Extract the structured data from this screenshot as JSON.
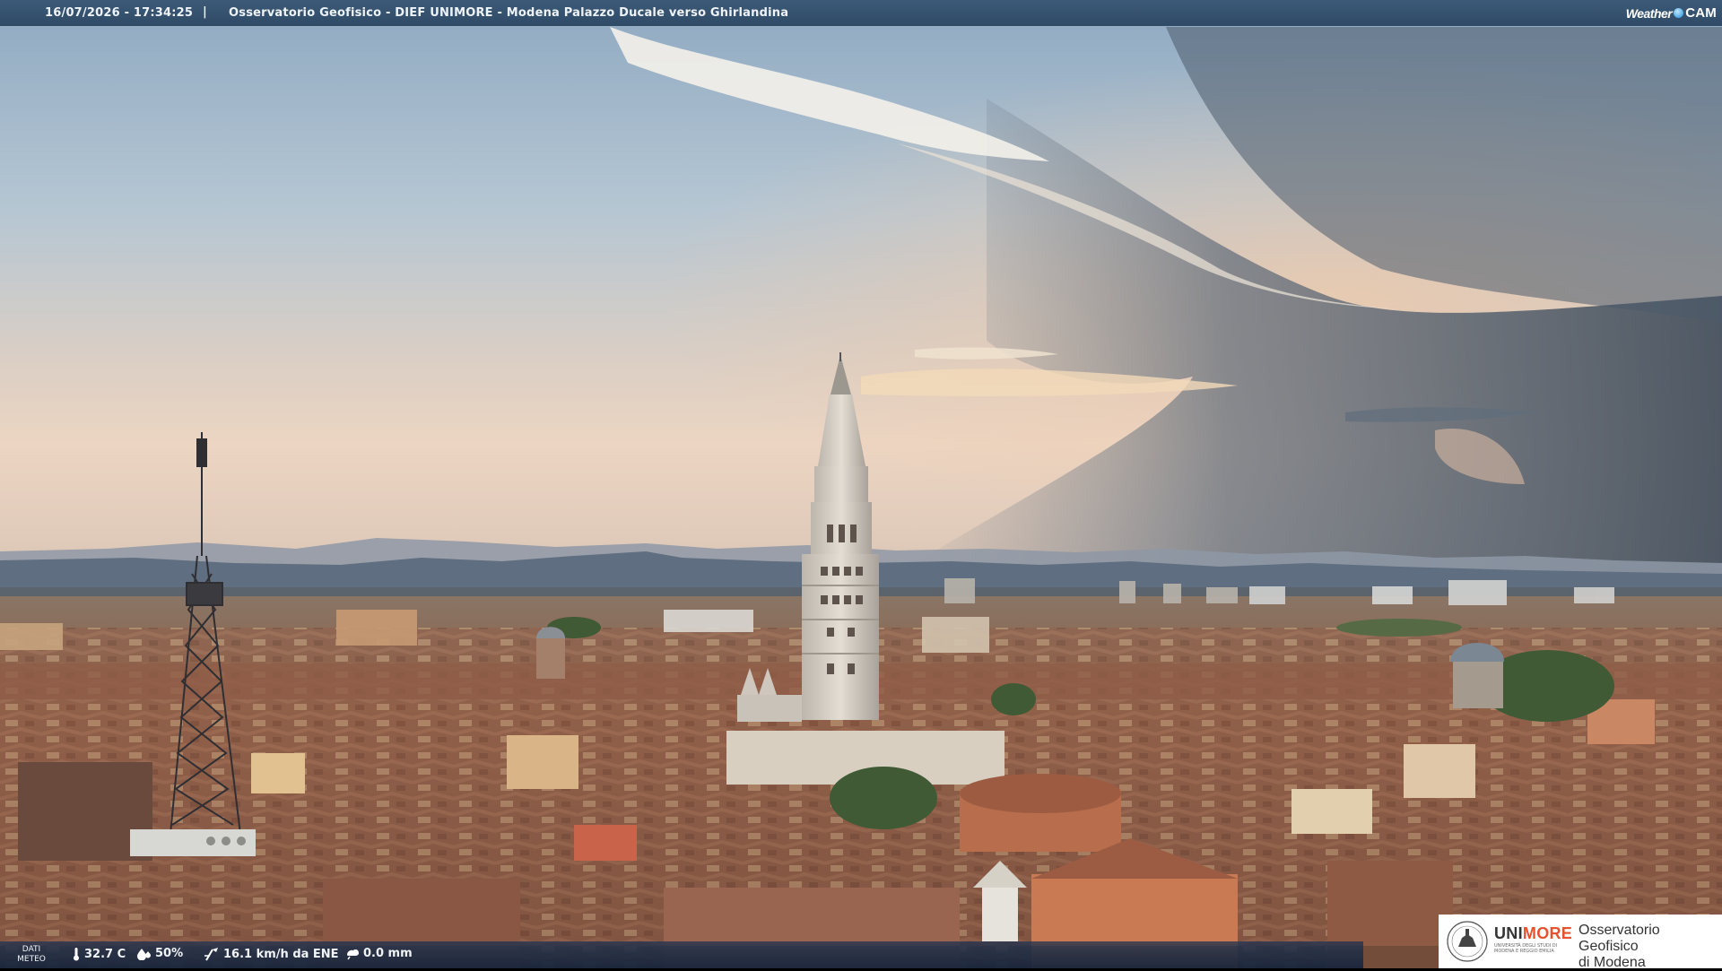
{
  "header": {
    "timestamp": "16/07/2026 - 17:34:25",
    "separator": "|",
    "title": "Osservatorio Geofisico - DIEF UNIMORE - Modena Palazzo Ducale verso Ghirlandina"
  },
  "brand": {
    "weather": "Weather",
    "cam": "CAM"
  },
  "weather_bar": {
    "label_line1": "DATI",
    "label_line2": "METEO",
    "temperature": "32.7 C",
    "humidity": "50%",
    "wind": "16.1 km/h da ENE",
    "rain": "0.0 mm",
    "icons": [
      "thermometer-icon",
      "humidity-icon",
      "wind-icon",
      "rain-icon"
    ]
  },
  "logo": {
    "uni": "UNI",
    "more": "MORE",
    "uni_sub": "UNIVERSITÀ DEGLI STUDI DI MODENA E REGGIO EMILIA",
    "obs_line1": "Osservatorio Geofisico",
    "obs_line2": "di Modena"
  },
  "colors": {
    "accent": "#e4532e",
    "topbar": "#34506e",
    "sky_top": "#a7bdd0",
    "sky_horizon": "#e8d4c2",
    "storm": "#4f5d6e",
    "roof": "#9a6a52"
  }
}
